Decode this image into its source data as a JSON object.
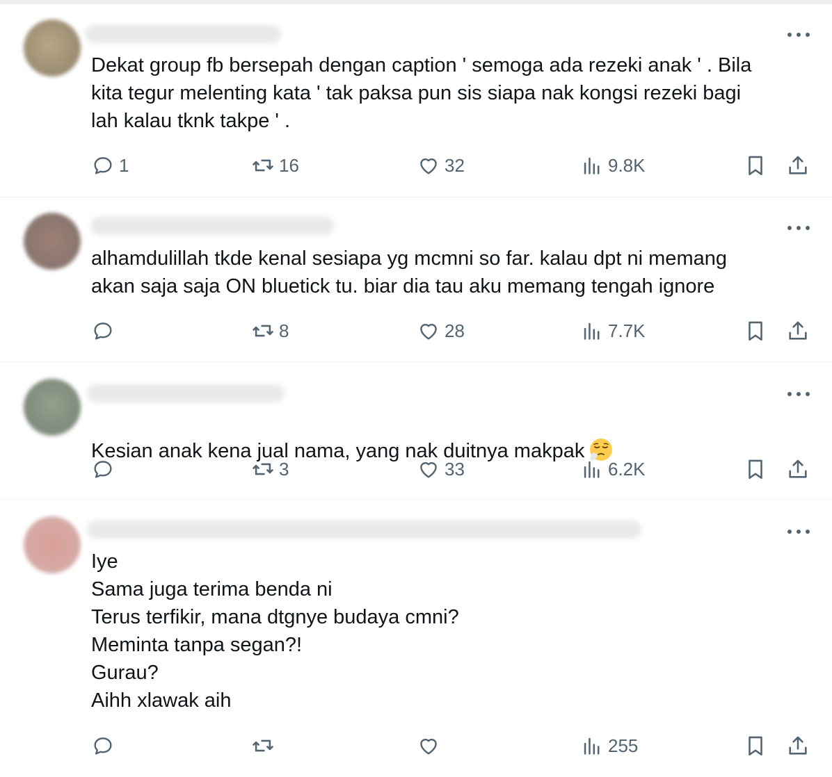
{
  "replies": [
    {
      "text": "Dekat group fb bersepah dengan caption ' semoga ada rezeki anak ' . Bila\nkita tegur melenting kata ' tak paksa pun sis siapa nak kongsi rezeki bagi\nlah kalau tknk takpe ' .",
      "stats": {
        "replies": "1",
        "reposts": "16",
        "likes": "32",
        "views": "9.8K"
      },
      "avatar_color": "#a99a7c"
    },
    {
      "text": "alhamdulillah tkde kenal sesiapa yg mcmni so far. kalau dpt ni memang\nakan saja saja ON bluetick tu. biar dia tau aku memang tengah ignore",
      "stats": {
        "replies": "",
        "reposts": "8",
        "likes": "28",
        "views": "7.7K"
      },
      "avatar_color": "#9b7f78"
    },
    {
      "text": "Kesian anak kena jual nama, yang nak duitnya makpak",
      "emoji": "relieved-sleepy-face",
      "stats": {
        "replies": "",
        "reposts": "3",
        "likes": "33",
        "views": "6.2K"
      },
      "avatar_color": "#8e9a88"
    },
    {
      "text": "Iye\nSama juga terima benda ni\nTerus terfikir, mana dtgnye budaya cmni?\nMeminta tanpa segan?!\nGurau?\nAihh xlawak aih",
      "stats": {
        "replies": "",
        "reposts": "",
        "likes": "",
        "views": "255"
      },
      "avatar_color": "#d8a4a0"
    }
  ],
  "icons": {
    "reply": "reply-bubble-icon",
    "repost": "repost-arrows-icon",
    "like": "heart-icon",
    "views": "views-bars-icon",
    "bookmark": "bookmark-icon",
    "share": "share-upload-icon",
    "more": "more-dots-icon"
  },
  "colors": {
    "text": "#0f1419",
    "muted": "#536471",
    "divider": "#eff3f4"
  }
}
